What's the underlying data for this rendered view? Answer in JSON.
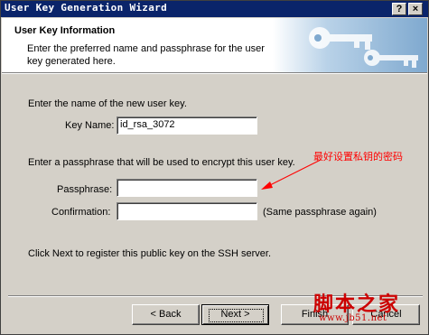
{
  "window": {
    "title": "User Key Generation Wizard",
    "help_btn": "?",
    "close_btn": "×"
  },
  "header": {
    "title": "User Key Information",
    "description": "Enter the preferred name and passphrase for the user key generated here."
  },
  "form": {
    "intro_name": "Enter the name of the new user key.",
    "key_name_label": "Key Name:",
    "key_name_value": "id_rsa_3072",
    "intro_pass": "Enter a passphrase that will be used to encrypt this user key.",
    "passphrase_label": "Passphrase:",
    "confirmation_label": "Confirmation:",
    "confirmation_note": "(Same passphrase again)",
    "footer_note": "Click Next to register this public key on the SSH server."
  },
  "annotation": {
    "text": "最好设置私钥的密码",
    "color": "#ff0000"
  },
  "buttons": {
    "back": "< Back",
    "next": "Next >",
    "finish": "Finish",
    "cancel": "Cancel"
  },
  "watermark": {
    "big": "脚本之家",
    "small": "www.jb51.net"
  },
  "colors": {
    "titlebar": "#0a246a",
    "face": "#d4d0c8",
    "annotation": "#ff0000"
  }
}
